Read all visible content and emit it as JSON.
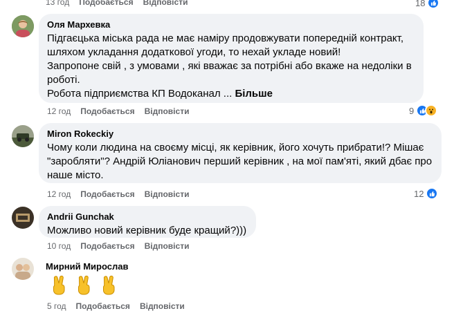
{
  "top": {
    "time": "13 год",
    "like": "Подобається",
    "reply": "Відповісти",
    "reaction_count": "18"
  },
  "comments": [
    {
      "author": "Оля Мархевка",
      "lines": [
        "Підгаєцька міська рада не має наміру продовжувати попередній контракт,",
        "шляхом укладання додаткової угоди, то нехай укладе новий!",
        "Запропоне свій , з умовами , які вважає за потрібні або вкаже на недоліки в",
        "роботі."
      ],
      "last_line": "Робота підприємства КП Водоканал ... ",
      "more": "Більше",
      "time": "12 год",
      "like": "Подобається",
      "reply": "Відповісти",
      "reaction_count": "9"
    },
    {
      "author": "Miron Rokeckiy",
      "lines": [
        "Чому коли людина на своєму місці, як керівник, його хочуть прибрати!? Мішає",
        "\"заробляти\"? Андрій Юліанович перший керівник , на мої пам'яті, який дбає про",
        "наше місто."
      ],
      "time": "12 год",
      "like": "Подобається",
      "reply": "Відповісти",
      "reaction_count": "12"
    },
    {
      "author": "Andrii Gunchak",
      "lines": [
        "Можливо новий керівник буде кращий?)))"
      ],
      "time": "10 год",
      "like": "Подобається",
      "reply": "Відповісти"
    },
    {
      "author": "Мирний Мирослав",
      "emojis": [
        "✌",
        "✌",
        "✌"
      ],
      "time": "5 год",
      "like": "Подобається",
      "reply": "Відповісти"
    }
  ],
  "colors": {
    "bubble": "#f0f2f5",
    "meta": "#65676b",
    "like": "#1877f2",
    "wow": "#f7b125"
  }
}
